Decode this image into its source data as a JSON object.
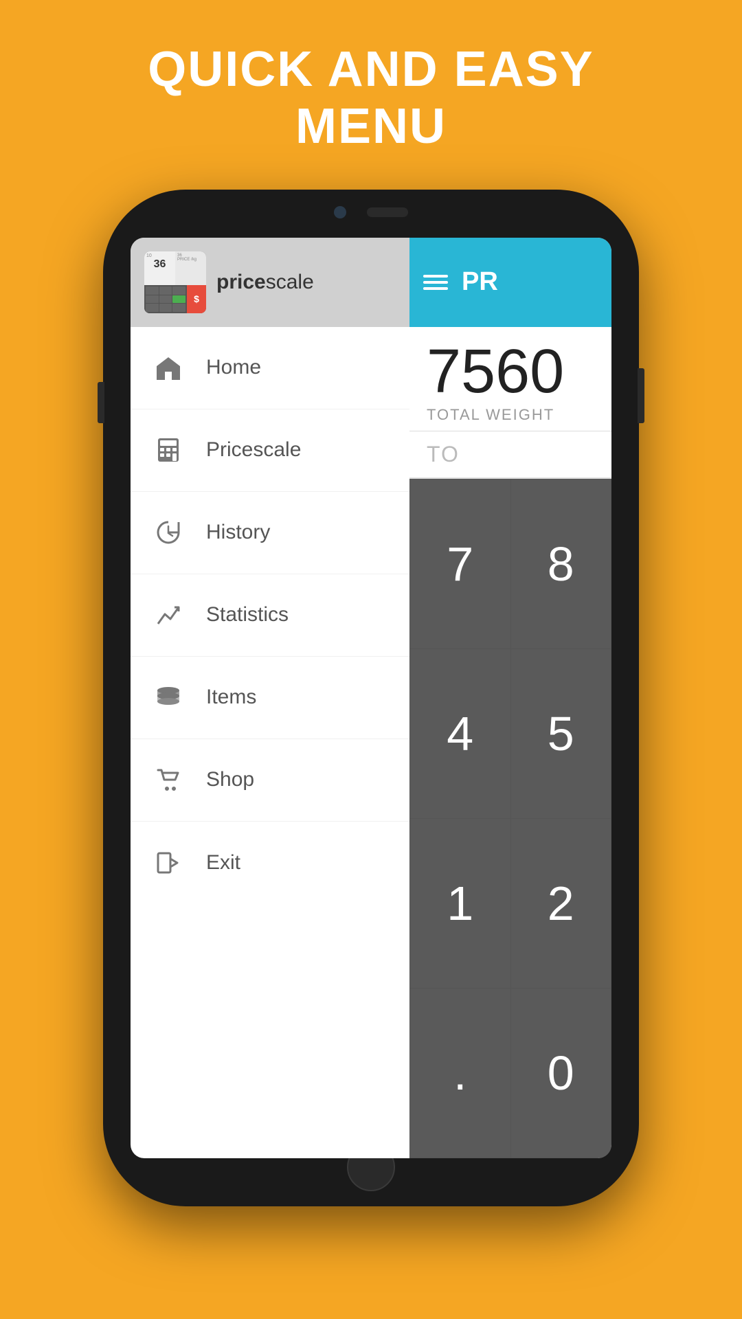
{
  "page": {
    "headline_line1": "QUICK AND EASY",
    "headline_line2": "MENU",
    "background_color": "#F5A623"
  },
  "app": {
    "name_bold": "price",
    "name_light": "scale",
    "toolbar_title": "PR",
    "display_number": "7560",
    "display_label": "TOTAL WEIGHT",
    "display_to": "TO",
    "hamburger_label": "☰"
  },
  "menu": {
    "items": [
      {
        "id": "home",
        "label": "Home",
        "icon": "⌂"
      },
      {
        "id": "pricescale",
        "label": "Pricescale",
        "icon": "⊞"
      },
      {
        "id": "history",
        "label": "History",
        "icon": "↺"
      },
      {
        "id": "statistics",
        "label": "Statistics",
        "icon": "↗"
      },
      {
        "id": "items",
        "label": "Items",
        "icon": "☰"
      },
      {
        "id": "shop",
        "label": "Shop",
        "icon": "🛒"
      },
      {
        "id": "exit",
        "label": "Exit",
        "icon": "⇥"
      }
    ]
  },
  "keypad": {
    "keys": [
      "7",
      "8",
      "4",
      "5",
      "1",
      "2",
      ".",
      "0"
    ]
  }
}
